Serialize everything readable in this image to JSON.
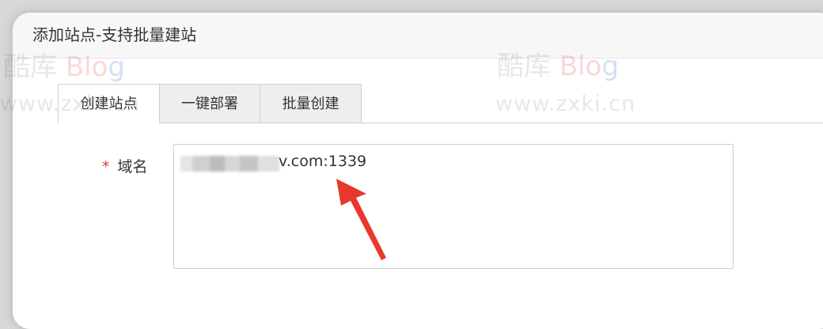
{
  "dialog": {
    "title": "添加站点-支持批量建站"
  },
  "tabs": [
    {
      "label": "创建站点",
      "active": true
    },
    {
      "label": "一键部署",
      "active": false
    },
    {
      "label": "批量创建",
      "active": false
    }
  ],
  "form": {
    "required_mark": "*",
    "domain_label": "域名",
    "domain_value_visible": "v.com:1339"
  },
  "watermark": {
    "logo_cn": "酷库",
    "logo_blog_prefix": "Blo",
    "logo_blog_suffix": "g",
    "url": "www.zxki.cn",
    "left_logo_cn": "酷库",
    "left_logo_blog_prefix": "Blo",
    "left_logo_blog_suffix": "g",
    "left_url": "www.zxki.cn"
  },
  "colors": {
    "required": "#e4393c",
    "arrow": "#e8382c"
  }
}
